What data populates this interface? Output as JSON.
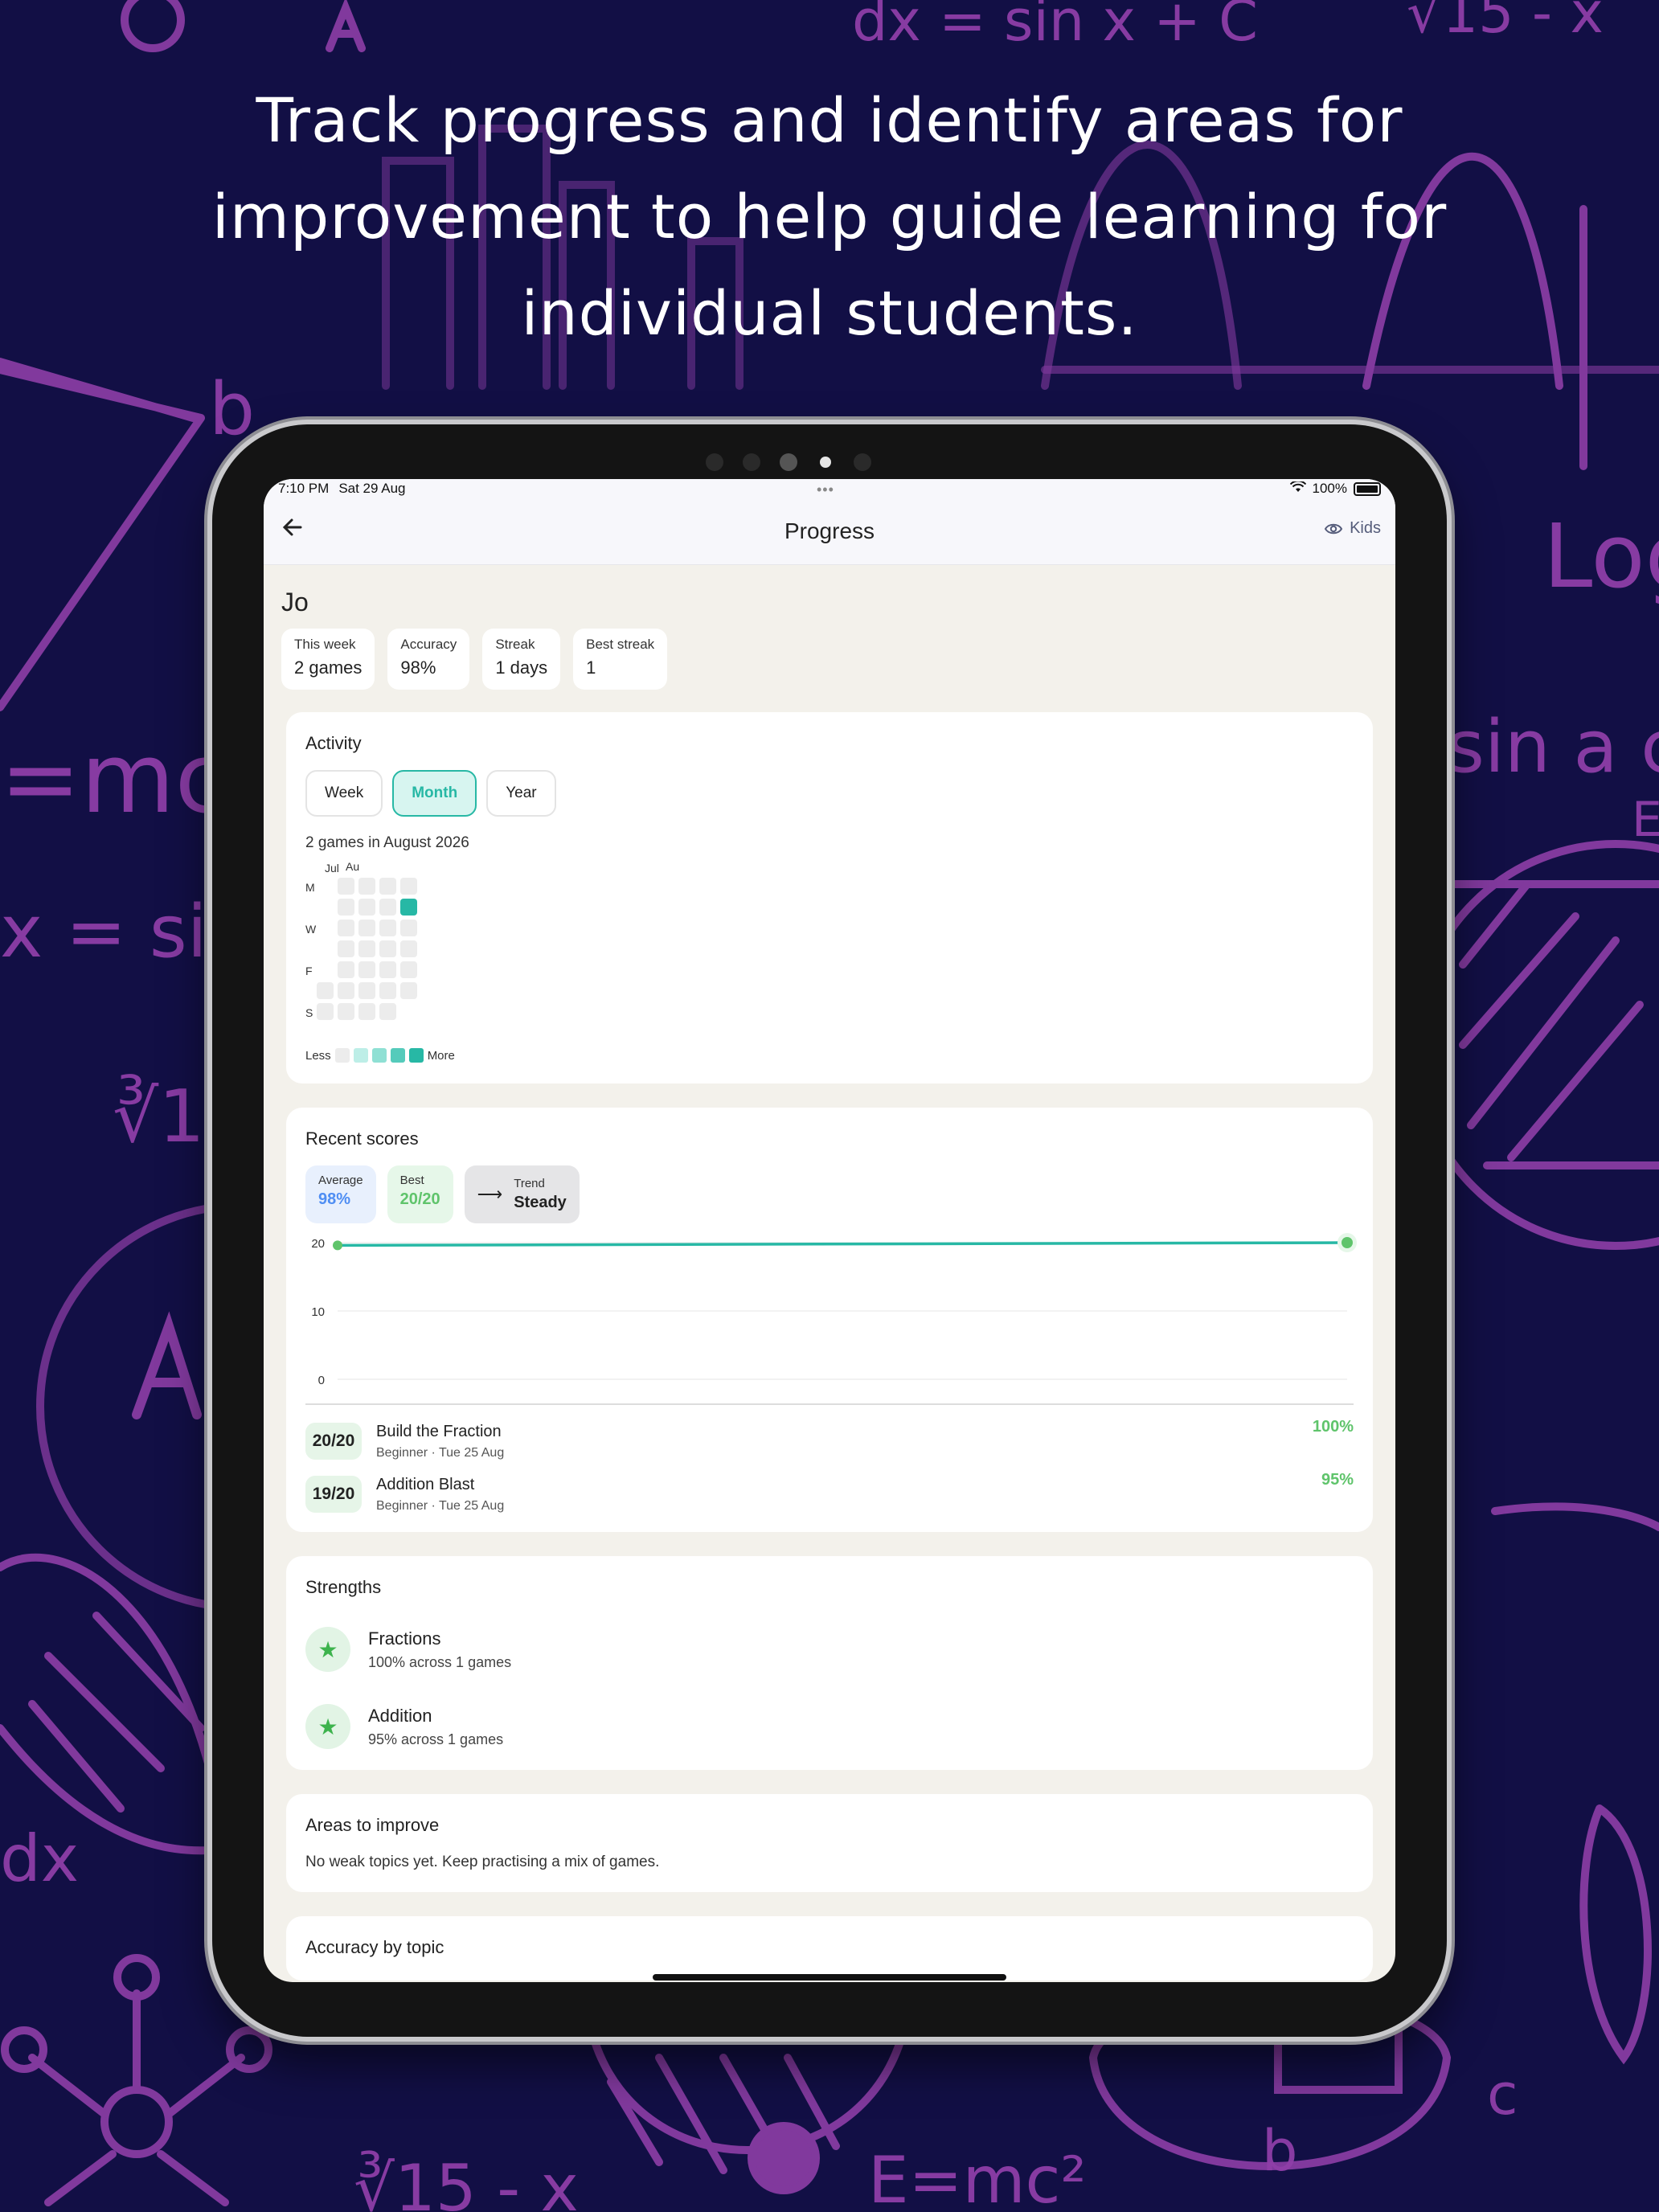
{
  "headline": {
    "line1": "Track progress and identify areas for",
    "line2": "improvement to help guide learning for",
    "line3": "individual students."
  },
  "colors": {
    "background": "#120f45",
    "doodle": "#8f3fa8",
    "accent": "#27b8a5",
    "success": "#5fc46b",
    "info": "#4f8ef3"
  },
  "status_bar": {
    "time": "7:10 PM",
    "date": "Sat 29 Aug",
    "dots": "•••",
    "battery": "100%"
  },
  "nav": {
    "title": "Progress",
    "kids_label": "Kids",
    "back_icon": "arrow-left-icon",
    "kids_icon": "eye-icon"
  },
  "student": {
    "name": "Jo"
  },
  "stats": [
    {
      "label": "This week",
      "value": "2 games"
    },
    {
      "label": "Accuracy",
      "value": "98%"
    },
    {
      "label": "Streak",
      "value": "1 days"
    },
    {
      "label": "Best streak",
      "value": "1"
    }
  ],
  "activity": {
    "title": "Activity",
    "tabs": [
      "Week",
      "Month",
      "Year"
    ],
    "selected_tab": "Month",
    "summary": "2 games in August 2026",
    "month_labels": [
      "Jul",
      "Au"
    ],
    "day_labels": [
      "M",
      "W",
      "F",
      "S"
    ],
    "legend_less": "Less",
    "legend_more": "More",
    "legend_colors": [
      "#ececec",
      "#bdeee7",
      "#8fe0d4",
      "#55cbbb",
      "#27b8a5"
    ],
    "active_cell": {
      "week": 4,
      "day": 1,
      "level": 4
    }
  },
  "recent_scores": {
    "title": "Recent scores",
    "average": {
      "label": "Average",
      "value": "98%"
    },
    "best": {
      "label": "Best",
      "value": "20/20"
    },
    "trend": {
      "label": "Trend",
      "value": "Steady",
      "icon": "arrow-right-icon"
    },
    "items": [
      {
        "score": "20/20",
        "name": "Build the Fraction",
        "meta": "Beginner · Tue 25 Aug",
        "percent": "100%"
      },
      {
        "score": "19/20",
        "name": "Addition Blast",
        "meta": "Beginner · Tue 25 Aug",
        "percent": "95%"
      }
    ]
  },
  "chart_data": {
    "type": "line",
    "title": "",
    "xlabel": "",
    "ylabel": "",
    "ylim": [
      0,
      20
    ],
    "y_ticks": [
      "20",
      "10",
      "0"
    ],
    "x": [
      1,
      2
    ],
    "series": [
      {
        "values": [
          19.6,
          20
        ],
        "color": "#27b8a5"
      }
    ],
    "grid": true
  },
  "strengths": {
    "title": "Strengths",
    "items": [
      {
        "name": "Fractions",
        "meta": "100% across 1 games",
        "icon": "star-icon"
      },
      {
        "name": "Addition",
        "meta": "95% across 1 games",
        "icon": "star-icon"
      }
    ]
  },
  "areas": {
    "title": "Areas to improve",
    "note": "No weak topics yet. Keep practising a mix of games."
  },
  "accuracy_topic": {
    "title": "Accuracy by topic"
  }
}
